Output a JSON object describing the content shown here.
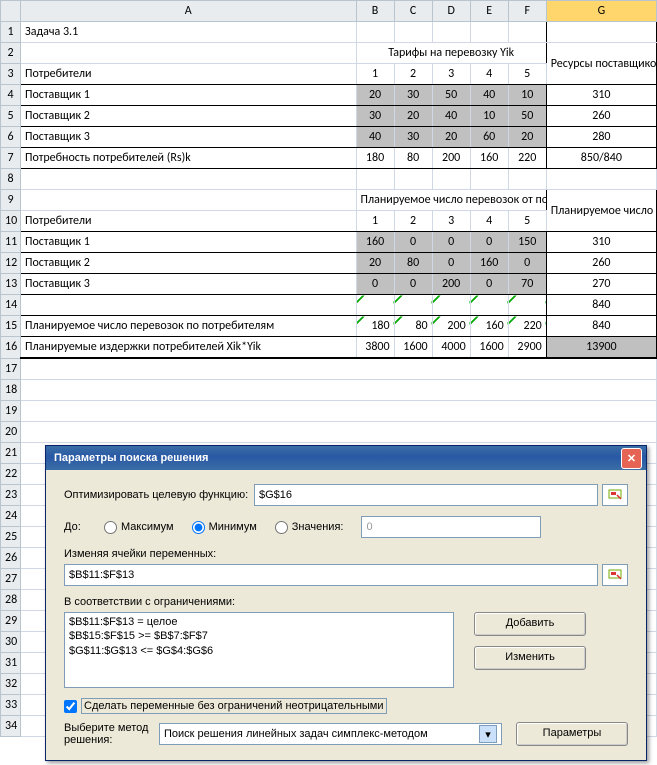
{
  "columns": [
    "",
    "A",
    "B",
    "C",
    "D",
    "E",
    "F",
    "G"
  ],
  "rowHeads": [
    "1",
    "2",
    "3",
    "4",
    "5",
    "6",
    "7",
    "8",
    "9",
    "10",
    "11",
    "12",
    "13",
    "14",
    "15",
    "16",
    "17",
    "18",
    "19",
    "20",
    "21",
    "22",
    "23",
    "24",
    "25",
    "26",
    "27",
    "28",
    "29",
    "30",
    "31",
    "32",
    "33",
    "34"
  ],
  "r1": {
    "a": "Задача 3.1"
  },
  "r2": {
    "bHead": "Тарифы на перевозку Yik",
    "g": "Ресурсы поставщиков (Rz)i"
  },
  "r3": {
    "a": "Потребители",
    "c": [
      "1",
      "2",
      "3",
      "4",
      "5"
    ]
  },
  "r4": {
    "a": "Поставщик 1",
    "v": [
      "20",
      "30",
      "50",
      "40",
      "10"
    ],
    "g": "310"
  },
  "r5": {
    "a": "Поставщик 2",
    "v": [
      "30",
      "20",
      "40",
      "10",
      "50"
    ],
    "g": "260"
  },
  "r6": {
    "a": "Поставщик 3",
    "v": [
      "40",
      "30",
      "20",
      "60",
      "20"
    ],
    "g": "280"
  },
  "r7": {
    "a": "Потребность потребителей (Rs)k",
    "v": [
      "180",
      "80",
      "200",
      "160",
      "220"
    ],
    "g": "850/840"
  },
  "r9": {
    "bHead": "Планируемое число перевозок от поставщика потребителю Xik",
    "g": "Планируемое число перевозок по поставщикам"
  },
  "r10": {
    "a": "Потребители",
    "c": [
      "1",
      "2",
      "3",
      "4",
      "5"
    ]
  },
  "r11": {
    "a": "Поставщик 1",
    "v": [
      "160",
      "0",
      "0",
      "0",
      "150"
    ],
    "g": "310"
  },
  "r12": {
    "a": "Поставщик 2",
    "v": [
      "20",
      "80",
      "0",
      "160",
      "0"
    ],
    "g": "260"
  },
  "r13": {
    "a": "Поставщик 3",
    "v": [
      "0",
      "0",
      "200",
      "0",
      "70"
    ],
    "g": "270"
  },
  "r14": {
    "g": "840"
  },
  "r15": {
    "a": "Планируемое число перевозок по потребителям",
    "v": [
      "180",
      "80",
      "200",
      "160",
      "220"
    ],
    "g": "840"
  },
  "r16": {
    "a": "Планируемые издержки потребителей Xik*Yik",
    "v": [
      "3800",
      "1600",
      "4000",
      "1600",
      "2900"
    ],
    "g": "13900"
  },
  "dialog": {
    "title": "Параметры поиска решения",
    "objLabel": "Оптимизировать целевую функцию:",
    "objCell": "$G$16",
    "toLabel": "До:",
    "optMax": "Максимум",
    "optMin": "Минимум",
    "optVal": "Значения:",
    "valField": "0",
    "changeLabel": "Изменяя ячейки переменных:",
    "changeCells": "$B$11:$F$13",
    "constrLabel": "В соответствии с ограничениями:",
    "constraints": [
      "$B$11:$F$13 = целое",
      "$B$15:$F$15 >= $B$7:$F$7",
      "$G$11:$G$13 <= $G$4:$G$6"
    ],
    "addBtn": "Добавить",
    "changeBtn": "Изменить",
    "nonNeg": "Сделать переменные без ограничений неотрицательными",
    "methodLabel": "Выберите метод решения:",
    "methodVal": "Поиск решения линейных задач симплекс-методом",
    "paramsBtn": "Параметры"
  }
}
